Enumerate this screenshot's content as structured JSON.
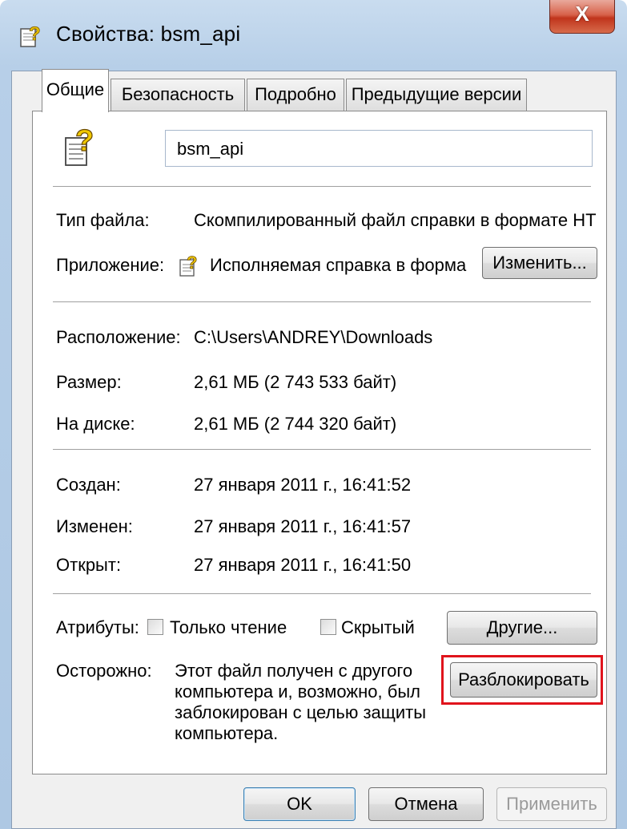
{
  "window": {
    "title": "Свойства: bsm_api",
    "close_glyph": "X",
    "title_icon": "help-file-icon"
  },
  "tabs": [
    {
      "label": "Общие",
      "active": true
    },
    {
      "label": "Безопасность",
      "active": false
    },
    {
      "label": "Подробно",
      "active": false
    },
    {
      "label": "Предыдущие версии",
      "active": false
    }
  ],
  "general": {
    "file_icon": "help-file-icon",
    "file_name": "bsm_api",
    "file_type_label": "Тип файла:",
    "file_type_value": "Скомпилированный файл справки в формате HT",
    "app_label": "Приложение:",
    "app_value": "Исполняемая справка в форма",
    "change_button": "Изменить...",
    "location_label": "Расположение:",
    "location_value": "C:\\Users\\ANDREY\\Downloads",
    "size_label": "Размер:",
    "size_value": "2,61 МБ (2 743 533 байт)",
    "disk_label": "На диске:",
    "disk_value": "2,61 МБ (2 744 320 байт)",
    "created_label": "Создан:",
    "created_value": "27 января 2011 г., 16:41:52",
    "modified_label": "Изменен:",
    "modified_value": "27 января 2011 г., 16:41:57",
    "opened_label": "Открыт:",
    "opened_value": "27 января 2011 г., 16:41:50",
    "attributes_label": "Атрибуты:",
    "readonly_label": "Только чтение",
    "readonly_checked": false,
    "hidden_label": "Скрытый",
    "hidden_checked": false,
    "other_button": "Другие...",
    "caution_label": "Осторожно:",
    "caution_lines": [
      "Этот файл получен с другого",
      "компьютера и, возможно, был",
      "заблокирован с целью защиты",
      "компьютера."
    ],
    "unblock_button": "Разблокировать",
    "highlight_color": "#e0141c"
  },
  "footer": {
    "ok": "OK",
    "cancel": "Отмена",
    "apply": "Применить"
  }
}
